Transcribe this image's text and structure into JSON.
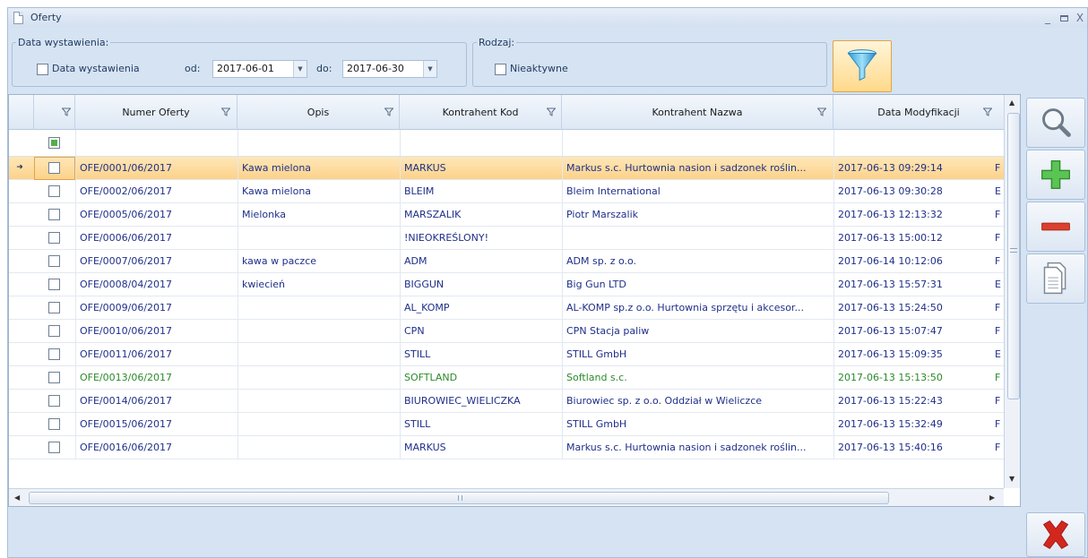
{
  "window": {
    "title": "Oferty"
  },
  "filters": {
    "date_group_caption": "Data wystawienia:",
    "date_checkbox_label": "Data wystawienia",
    "from_label": "od:",
    "from_value": "2017-06-01",
    "to_label": "do:",
    "to_value": "2017-06-30",
    "kind_group_caption": "Rodzaj:",
    "inactive_label": "Nieaktywne"
  },
  "grid": {
    "columns": {
      "numer": "Numer Oferty",
      "opis": "Opis",
      "kod": "Kontrahent Kod",
      "nazwa": "Kontrahent Nazwa",
      "data": "Data Modyfikacji"
    },
    "rows": [
      {
        "numer": "OFE/0001/06/2017",
        "opis": "Kawa mielona",
        "kod": "MARKUS",
        "nazwa": "Markus s.c. Hurtownia nasion i sadzonek roślin...",
        "data": "2017-06-13 09:29:14",
        "extra": "F",
        "selected": true
      },
      {
        "numer": "OFE/0002/06/2017",
        "opis": "Kawa mielona",
        "kod": "BLEIM",
        "nazwa": "Bleim International",
        "data": "2017-06-13 09:30:28",
        "extra": "E"
      },
      {
        "numer": "OFE/0005/06/2017",
        "opis": "Mielonka",
        "kod": "MARSZALIK",
        "nazwa": "Piotr Marszalik",
        "data": "2017-06-13 12:13:32",
        "extra": "F"
      },
      {
        "numer": "OFE/0006/06/2017",
        "opis": "",
        "kod": "!NIEOKREŚLONY!",
        "nazwa": "",
        "data": "2017-06-13 15:00:12",
        "extra": "F"
      },
      {
        "numer": "OFE/0007/06/2017",
        "opis": "kawa w paczce",
        "kod": "ADM",
        "nazwa": "ADM sp. z o.o.",
        "data": "2017-06-14 10:12:06",
        "extra": "F"
      },
      {
        "numer": "OFE/0008/04/2017",
        "opis": "kwiecień",
        "kod": "BIGGUN",
        "nazwa": "Big Gun LTD",
        "data": "2017-06-13 15:57:31",
        "extra": "E"
      },
      {
        "numer": "OFE/0009/06/2017",
        "opis": "",
        "kod": "AL_KOMP",
        "nazwa": "AL-KOMP sp.z o.o. Hurtownia sprzętu i akcesor...",
        "data": "2017-06-13 15:24:50",
        "extra": "F"
      },
      {
        "numer": "OFE/0010/06/2017",
        "opis": "",
        "kod": "CPN",
        "nazwa": "CPN Stacja paliw",
        "data": "2017-06-13 15:07:47",
        "extra": "F"
      },
      {
        "numer": "OFE/0011/06/2017",
        "opis": "",
        "kod": "STILL",
        "nazwa": "STILL GmbH",
        "data": "2017-06-13 15:09:35",
        "extra": "E"
      },
      {
        "numer": "OFE/0013/06/2017",
        "opis": "",
        "kod": "SOFTLAND",
        "nazwa": "Softland s.c.",
        "data": "2017-06-13 15:13:50",
        "extra": "F",
        "green": true
      },
      {
        "numer": "OFE/0014/06/2017",
        "opis": "",
        "kod": "BIUROWIEC_WIELICZKA",
        "nazwa": "Biurowiec sp. z o.o. Oddział w Wieliczce",
        "data": "2017-06-13 15:22:43",
        "extra": "F"
      },
      {
        "numer": "OFE/0015/06/2017",
        "opis": "",
        "kod": "STILL",
        "nazwa": "STILL GmbH",
        "data": "2017-06-13 15:32:49",
        "extra": "F"
      },
      {
        "numer": "OFE/0016/06/2017",
        "opis": "",
        "kod": "MARKUS",
        "nazwa": "Markus s.c. Hurtownia nasion i sadzonek roślin...",
        "data": "2017-06-13 15:40:16",
        "extra": "F"
      }
    ]
  },
  "icons": {
    "filter": "funnel-icon",
    "search": "search-icon",
    "add": "plus-icon",
    "remove": "minus-icon",
    "copy": "copy-document-icon",
    "close": "close-x-icon"
  },
  "colors": {
    "selected_row": "#fcd28a",
    "text_link": "#1f2f8a",
    "green_row": "#2b8a2b",
    "add_green": "#3fa93a",
    "remove_red": "#d9412e",
    "close_red": "#d3271e"
  }
}
